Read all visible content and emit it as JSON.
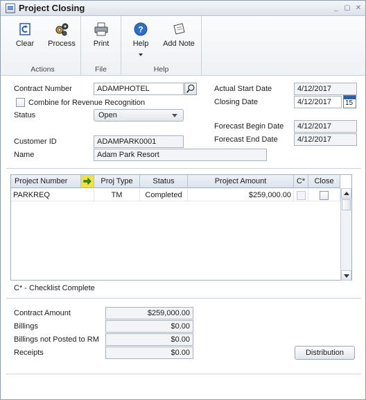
{
  "window": {
    "title": "Project Closing",
    "controls": [
      "_",
      "▢",
      "✕"
    ]
  },
  "ribbon": {
    "actions": {
      "clear": "Clear",
      "process": "Process",
      "group": "Actions"
    },
    "file": {
      "print": "Print",
      "group": "File"
    },
    "help": {
      "help": "Help",
      "add_note": "Add Note",
      "group": "Help"
    }
  },
  "form": {
    "contract_number_label": "Contract Number",
    "contract_number": "ADAMPHOTEL",
    "combine_label": "Combine for Revenue Recognition",
    "status_label": "Status",
    "status_value": "Open",
    "actual_start_label": "Actual Start Date",
    "actual_start": "4/12/2017",
    "closing_date_label": "Closing Date",
    "closing_date": "4/12/2017",
    "calendar_day": "15",
    "forecast_begin_label": "Forecast Begin Date",
    "forecast_begin": "4/12/2017",
    "forecast_end_label": "Forecast End Date",
    "forecast_end": "4/12/2017",
    "customer_id_label": "Customer ID",
    "customer_id": "ADAMPARK0001",
    "name_label": "Name",
    "name": "Adam Park Resort"
  },
  "grid": {
    "headers": [
      "Project Number",
      "Proj Type",
      "Status",
      "Project Amount",
      "C*",
      "Close"
    ],
    "rows": [
      {
        "project_number": "PARKREQ",
        "proj_type": "TM",
        "status": "Completed",
        "amount": "$259,000.00"
      }
    ],
    "legend": "C* - Checklist Complete"
  },
  "totals": {
    "contract_amount_label": "Contract Amount",
    "contract_amount": "$259,000.00",
    "billings_label": "Billings",
    "billings": "$0.00",
    "billings_not_posted_label": "Billings not Posted to RM",
    "billings_not_posted": "$0.00",
    "receipts_label": "Receipts",
    "receipts": "$0.00",
    "distribution_button": "Distribution"
  }
}
